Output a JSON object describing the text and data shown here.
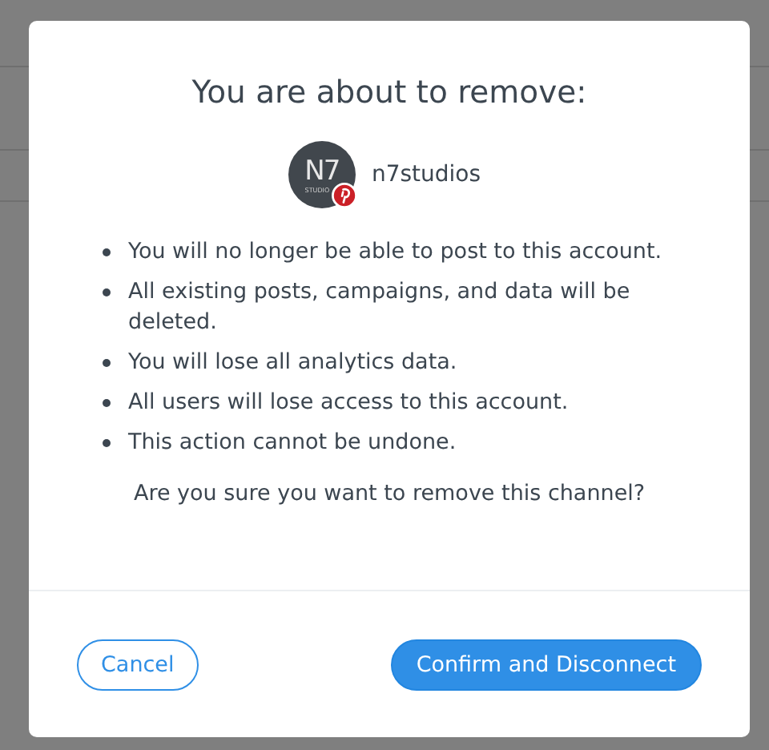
{
  "dialog": {
    "title": "You are about to remove:",
    "account": {
      "avatar_mark": "N7",
      "avatar_submark": "STUDIO",
      "kind": "pinterest",
      "name": "n7studios"
    },
    "consequences": [
      "You will no longer be able to post to this account.",
      "All existing posts, campaigns, and data will be deleted.",
      "You will lose all analytics data.",
      "All users will lose access to this account.",
      "This action cannot be undone."
    ],
    "question": "Are you sure you want to remove this channel?",
    "buttons": [
      {
        "label": "Cancel",
        "kind": "secondary"
      },
      {
        "label": "Confirm and Disconnect",
        "kind": "primary"
      }
    ]
  }
}
